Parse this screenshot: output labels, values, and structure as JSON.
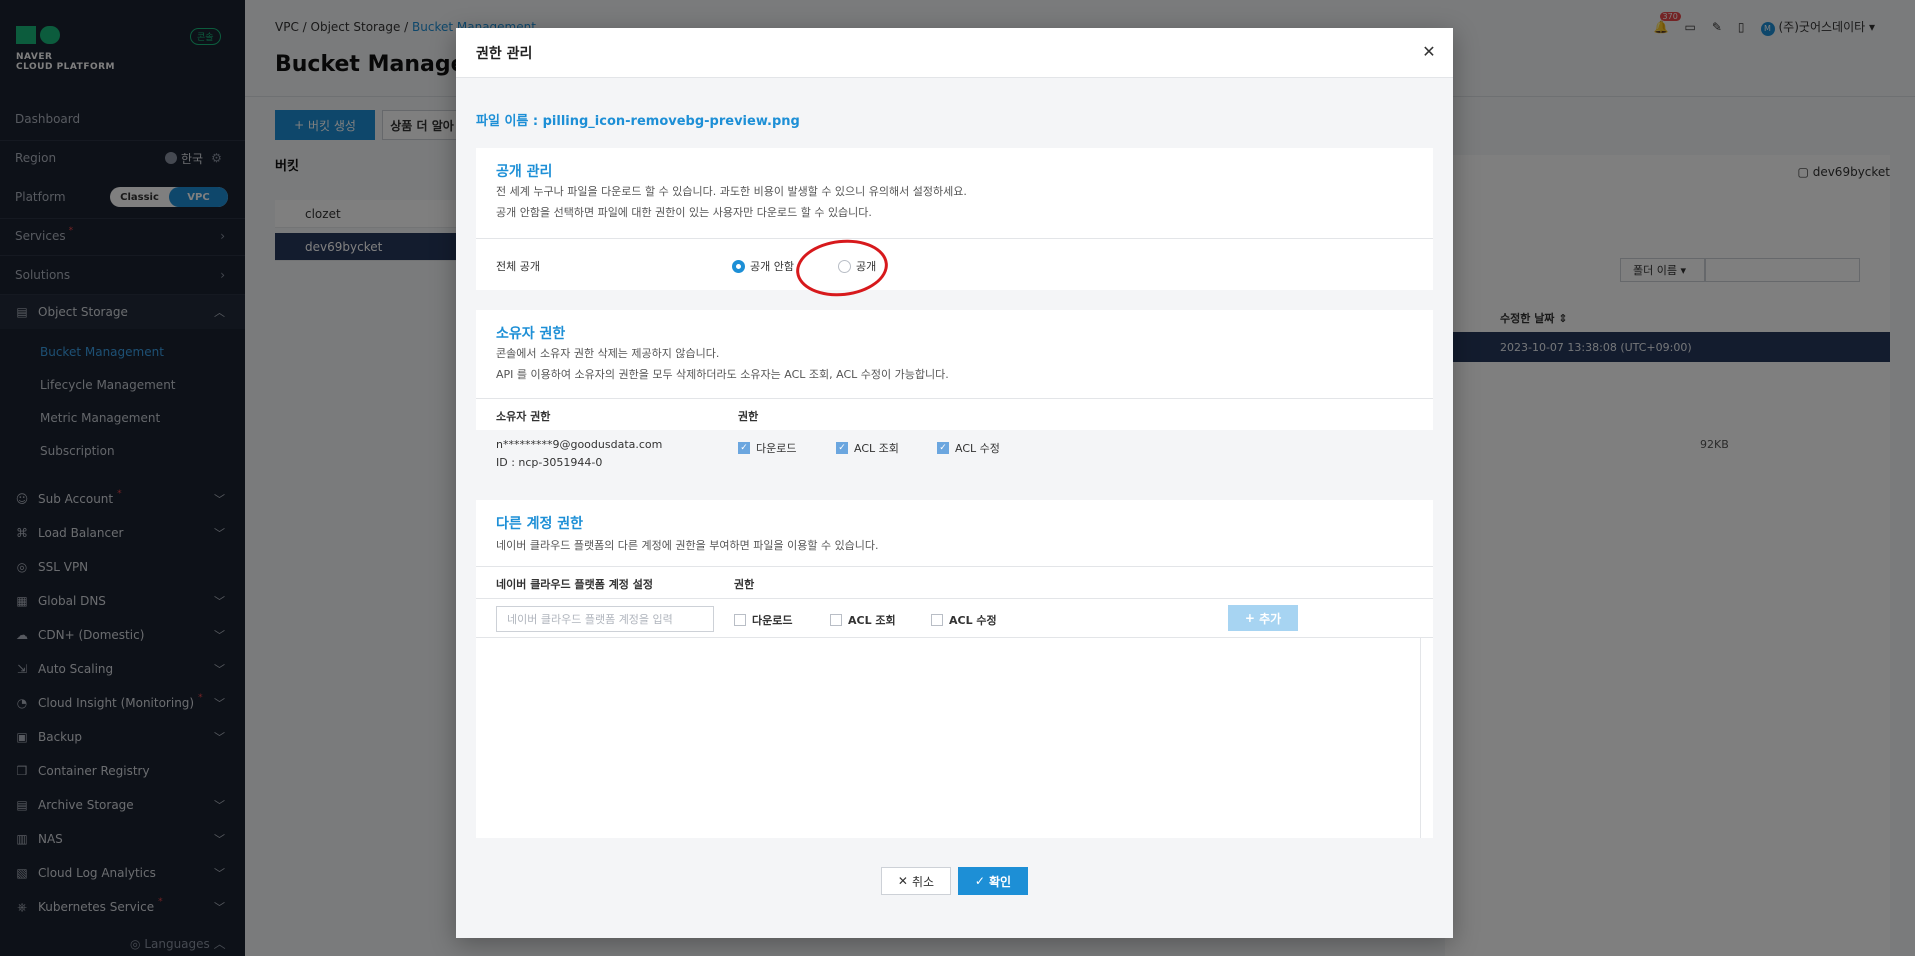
{
  "sidebar": {
    "logo_line1": "NAVER",
    "logo_line2": "CLOUD PLATFORM",
    "badge": "콘솔",
    "dashboard": "Dashboard",
    "region_label": "Region",
    "region_value": "한국",
    "platform_label": "Platform",
    "platform_classic": "Classic",
    "platform_vpc": "VPC",
    "services": "Services",
    "solutions": "Solutions",
    "object_storage": "Object Storage",
    "object_storage_items": [
      "Bucket Management",
      "Lifecycle Management",
      "Metric Management",
      "Subscription"
    ],
    "items": [
      {
        "label": "Sub Account",
        "star": true,
        "chevron": true,
        "icon": "user-icon"
      },
      {
        "label": "Load Balancer",
        "star": false,
        "chevron": true,
        "icon": "network-icon"
      },
      {
        "label": "SSL VPN",
        "star": false,
        "chevron": false,
        "icon": "shield-icon"
      },
      {
        "label": "Global DNS",
        "star": false,
        "chevron": true,
        "icon": "dns-icon"
      },
      {
        "label": "CDN+ (Domestic)",
        "star": false,
        "chevron": true,
        "icon": "cloud-icon"
      },
      {
        "label": "Auto Scaling",
        "star": false,
        "chevron": true,
        "icon": "scaling-icon"
      },
      {
        "label": "Cloud Insight (Monitoring)",
        "star": true,
        "chevron": true,
        "icon": "monitor-icon"
      },
      {
        "label": "Backup",
        "star": false,
        "chevron": true,
        "icon": "backup-icon"
      },
      {
        "label": "Container Registry",
        "star": false,
        "chevron": false,
        "icon": "container-icon"
      },
      {
        "label": "Archive Storage",
        "star": false,
        "chevron": true,
        "icon": "archive-icon"
      },
      {
        "label": "NAS",
        "star": false,
        "chevron": true,
        "icon": "nas-icon"
      },
      {
        "label": "Cloud Log Analytics",
        "star": false,
        "chevron": true,
        "icon": "log-icon"
      },
      {
        "label": "Kubernetes Service",
        "star": true,
        "chevron": true,
        "icon": "kubernetes-icon"
      }
    ],
    "languages": "Languages"
  },
  "header": {
    "breadcrumb": [
      "VPC",
      "Object Storage",
      "Bucket Management"
    ],
    "title": "Bucket Manager",
    "notification_count": "370",
    "user_initial": "M",
    "user_name": "(주)굿어스데이타"
  },
  "main": {
    "create_bucket": "버킷 생성",
    "more_button": "상품 더 알아",
    "bucket_heading": "버킷",
    "buckets": [
      "clozet",
      "dev69bycket"
    ],
    "folder_label": "dev69bycket",
    "folder_select": "폴더 이름",
    "col_modified": "수정한 날짜",
    "row_modified": "2023-10-07 13:38:08 (UTC+09:00)",
    "size_note": "92KB"
  },
  "modal": {
    "title": "권한 관리",
    "filename": "파일 이름 : pilling_icon-removebg-preview.png",
    "public": {
      "title": "공개 관리",
      "desc1": "전 세계 누구나 파일을 다운로드 할 수 있습니다. 과도한 비용이 발생할 수 있으니 유의해서 설정하세요.",
      "desc2": "공개 안함을 선택하면 파일에 대한 권한이 있는 사용자만 다운로드 할 수 있습니다.",
      "row_label": "전체 공개",
      "opt_private": "공개 안함",
      "opt_public": "공개",
      "selected": "공개 안함"
    },
    "owner": {
      "title": "소유자 권한",
      "desc1": "콘솔에서 소유자 권한 삭제는 제공하지 않습니다.",
      "desc2": "API 를 이용하여 소유자의 권한을 모두 삭제하더라도 소유자는 ACL 조회, ACL 수정이 가능합니다.",
      "col_owner": "소유자 권한",
      "col_perm": "권한",
      "email": "n*********9@goodusdata.com",
      "id": "ID : ncp-3051944-0",
      "perms": [
        "다운로드",
        "ACL 조회",
        "ACL 수정"
      ]
    },
    "other": {
      "title": "다른 계정 권한",
      "desc": "네이버 클라우드 플랫폼의 다른 계정에 권한을 부여하면 파일을 이용할 수 있습니다.",
      "col_account": "네이버 클라우드 플랫폼 계정 설정",
      "col_perm": "권한",
      "placeholder": "네이버 클라우드 플랫폼 계정을 입력",
      "perms": [
        "다운로드",
        "ACL 조회",
        "ACL 수정"
      ],
      "add": "추가"
    },
    "cancel": "취소",
    "ok": "확인"
  }
}
